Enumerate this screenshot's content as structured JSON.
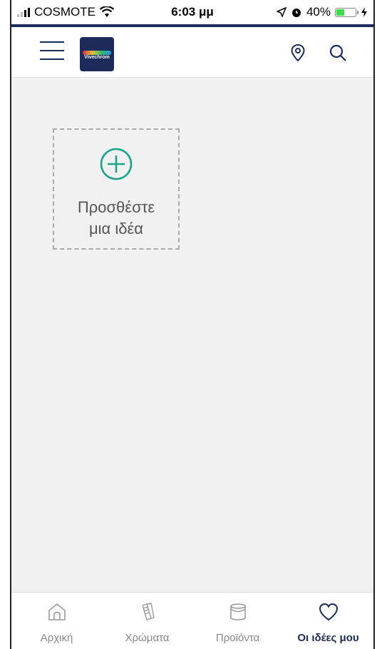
{
  "status_bar": {
    "carrier": "COSMOTE",
    "time": "6:03 μμ",
    "battery": "40%",
    "battery_level": 0.4
  },
  "header": {
    "logo_text": "Vivechrom",
    "menu_icon": "hamburger-menu-icon",
    "location_icon": "location-pin-icon",
    "search_icon": "search-icon"
  },
  "main": {
    "add_idea_line1": "Προσθέστε",
    "add_idea_line2": "μια ιδέα",
    "add_icon": "plus-circle-icon"
  },
  "nav": {
    "items": [
      {
        "label": "Αρχική",
        "icon": "home-icon",
        "active": false
      },
      {
        "label": "Χρώματα",
        "icon": "color-swatch-icon",
        "active": false
      },
      {
        "label": "Προϊόντα",
        "icon": "paint-bucket-icon",
        "active": false
      },
      {
        "label": "Οι ιδέες μου",
        "icon": "heart-icon",
        "active": true
      }
    ]
  },
  "colors": {
    "brand": "#1c2b5a",
    "accent": "#1aa58a",
    "background": "#f1f1f1"
  }
}
